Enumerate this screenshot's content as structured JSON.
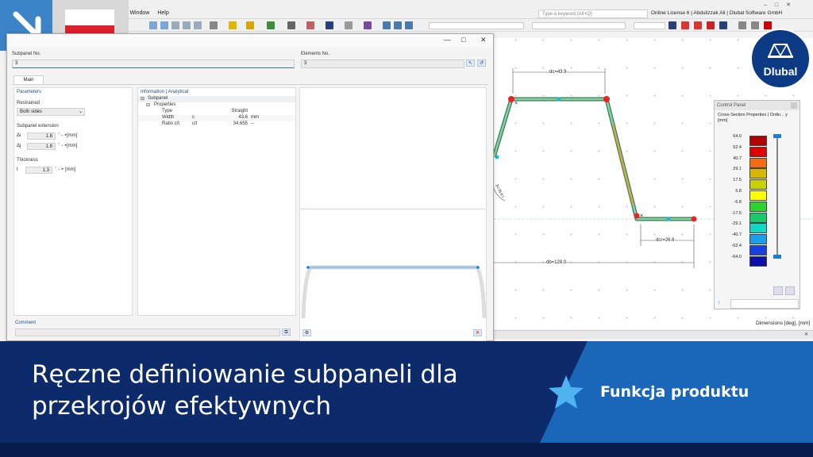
{
  "app": {
    "menu_items": [
      "s",
      "Window",
      "Help"
    ],
    "search_placeholder": "Type a keyword (Alt+Q)",
    "license_text": "Online License 6 | Abdulizzak Ali | Dlubal Software GmbH",
    "window_controls": [
      "–",
      "□",
      "✕"
    ]
  },
  "dialog": {
    "window_controls": [
      "—",
      "□",
      "✕"
    ],
    "subpanel_no_label": "Subpanel No.",
    "subpanel_no_value": "3",
    "elements_no_label": "Elements No.",
    "elements_no_value": "3",
    "tab_main": "Main",
    "parameters": {
      "header": "Parameters",
      "restrained_label": "Restrained",
      "restrained_value": "Both sides",
      "extension_label": "Subpanel extension",
      "di_symbol": "Δi",
      "di_value": "1.8",
      "dj_symbol": "Δj",
      "dj_value": "1.8",
      "unit_mm": "[mm]",
      "thickness_label": "Thickness",
      "t_symbol": "t",
      "t_value": "1.3"
    },
    "info": {
      "header": "Information | Analytical",
      "subpanel": "Subpanel",
      "properties": "Properties",
      "rows": [
        {
          "name": "Type",
          "symbol": "",
          "value": "Straight",
          "unit": ""
        },
        {
          "name": "Width",
          "symbol": "c",
          "value": "43.6",
          "unit": "mm"
        },
        {
          "name": "Ratio c/t",
          "symbol": "c/t",
          "value": "34.655",
          "unit": "--"
        }
      ]
    },
    "comment_label": "Comment"
  },
  "viewport": {
    "dim_top": "dc=43.9",
    "dim_right": "dcr=26.6",
    "dim_bottom": "db=128.0",
    "dim_left_partial": "δ=76.6 t",
    "footer_text": "Dimensions [deg], [mm]"
  },
  "control_panel": {
    "title": "Control Panel",
    "subtitle": "Cross-Section Properties | Ordin... y [mm]",
    "legend": [
      {
        "value": "64.0",
        "color": "#b30000"
      },
      {
        "value": "52.4",
        "color": "#e00000"
      },
      {
        "value": "40.7",
        "color": "#f26a12"
      },
      {
        "value": "29.1",
        "color": "#d7b800"
      },
      {
        "value": "17.5",
        "color": "#c7d200"
      },
      {
        "value": "5.8",
        "color": "#ffff00"
      },
      {
        "value": "-5.8",
        "color": "#2fd32f"
      },
      {
        "value": "-17.5",
        "color": "#18c96a"
      },
      {
        "value": "-29.1",
        "color": "#11d8c4"
      },
      {
        "value": "-40.7",
        "color": "#1aa0ea"
      },
      {
        "value": "-52.4",
        "color": "#1740e0"
      },
      {
        "value": "-64.0",
        "color": "#0e0ea8"
      }
    ]
  },
  "banner": {
    "title": "Ręczne definiowanie subpaneli dla przekrojów efektywnych",
    "feature": "Funkcja produktu"
  },
  "logo": {
    "text": "Dlubal"
  }
}
